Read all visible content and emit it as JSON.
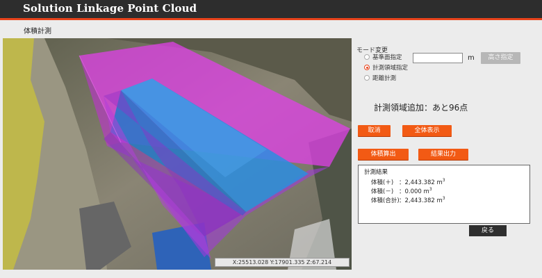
{
  "app": {
    "title": "Solution Linkage Point Cloud",
    "page_heading": "体積計測"
  },
  "viewer": {
    "coord_readout": "X:25513.028 Y:17901.335 Z:67.214"
  },
  "mode": {
    "label": "モード変更",
    "options": [
      {
        "label": "基準面指定",
        "checked": false
      },
      {
        "label": "計測領域指定",
        "checked": true
      },
      {
        "label": "距離計測",
        "checked": false
      }
    ],
    "height_value": "",
    "unit": "m",
    "height_button": "高さ指定"
  },
  "status": "計測領域追加：あと96点",
  "buttons": {
    "cancel": "取消",
    "show_all": "全体表示",
    "calculate": "体積算出",
    "export": "結果出力",
    "back": "戻る"
  },
  "results": {
    "heading": "計測結果",
    "rows": [
      {
        "label": "体積(＋)",
        "value": "：2,443.382 m",
        "unit_exp": "3"
      },
      {
        "label": "体積(－)",
        "value": "：0.000 m",
        "unit_exp": "3"
      },
      {
        "label": "体積(合計)",
        "value": "：2,443.382 m",
        "unit_exp": "3"
      }
    ]
  },
  "colors": {
    "accent": "#e8431b",
    "button": "#f25a14",
    "measure_area": "#e040e8",
    "reference_plane": "#2b8de0"
  }
}
